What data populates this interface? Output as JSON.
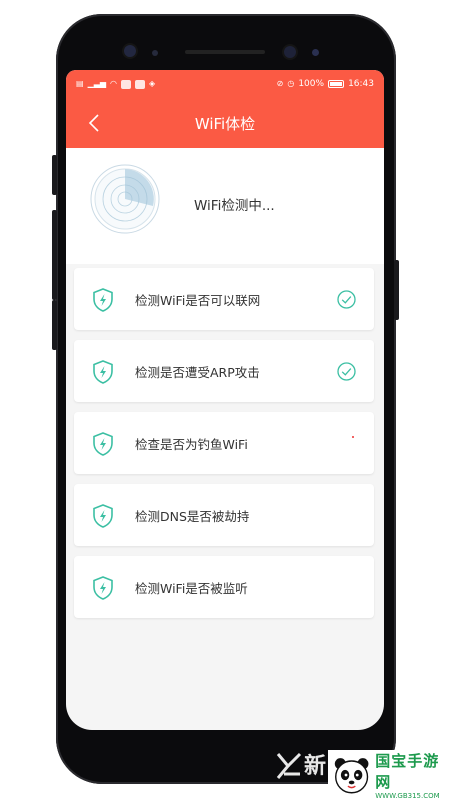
{
  "status_bar": {
    "battery_percent": "100%",
    "time": "16:43"
  },
  "app_bar": {
    "title": "WiFi体检"
  },
  "header": {
    "status_text": "WiFi检测中..."
  },
  "checks": [
    {
      "label": "检测WiFi是否可以联网",
      "state": "done"
    },
    {
      "label": "检测是否遭受ARP攻击",
      "state": "done"
    },
    {
      "label": "检查是否为钓鱼WiFi",
      "state": "in-progress"
    },
    {
      "label": "检测DNS是否被劫持",
      "state": "pending"
    },
    {
      "label": "检测WiFi是否被监听",
      "state": "pending"
    }
  ],
  "watermark": {
    "xin": "新",
    "title": "国宝手游网",
    "url": "WWW.GB315.COM"
  },
  "colors": {
    "accent": "#fb5a44",
    "teal": "#3bbfa3",
    "phone": "#0b0b0d"
  }
}
